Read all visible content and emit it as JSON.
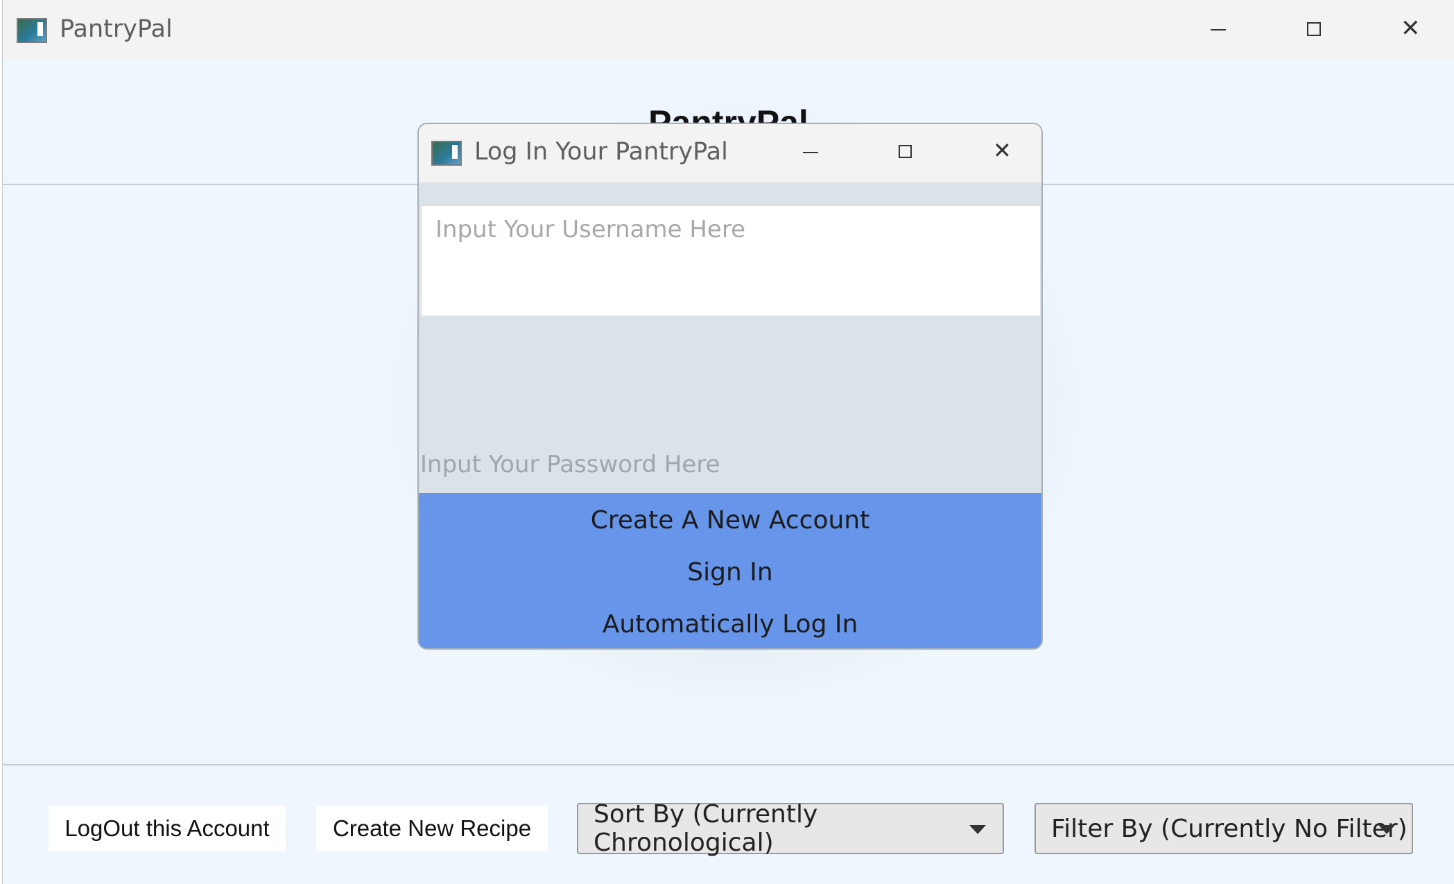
{
  "main_window": {
    "title": "PantryPal",
    "heading": "PantryPal",
    "controls": {
      "minimize": "minimize-icon",
      "maximize": "maximize-icon",
      "close": "close-icon"
    }
  },
  "toolbar": {
    "logout_label": "LogOut this Account",
    "create_recipe_label": "Create New Recipe",
    "sort_label": "Sort By (Currently Chronological)",
    "filter_label": "Filter By (Currently No Filter)"
  },
  "dialog": {
    "title": "Log In Your PantryPal",
    "username_placeholder": "Input Your Username Here",
    "password_placeholder": "Input Your Password Here",
    "create_account_label": "Create A New Account",
    "sign_in_label": "Sign In",
    "auto_login_label": "Automatically Log In"
  },
  "colors": {
    "window_bg": "#eff6fe",
    "titlebar_bg": "#f3f3f3",
    "dialog_bg": "#dbe3e8",
    "button_blue": "#6695ea"
  }
}
